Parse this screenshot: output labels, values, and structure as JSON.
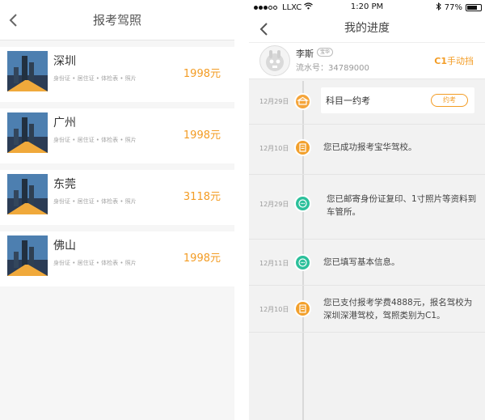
{
  "left_screen": {
    "title": "报考驾照",
    "cities": [
      {
        "name": "深圳",
        "docs": "身份证 • 居住证 • 体检表 • 照片",
        "price": "1998元"
      },
      {
        "name": "广州",
        "docs": "身份证 • 居住证 • 体检表 • 照片",
        "price": "1998元"
      },
      {
        "name": "东莞",
        "docs": "身份证 • 居住证 • 体检表 • 照片",
        "price": "3118元"
      },
      {
        "name": "佛山",
        "docs": "身份证 • 居住证 • 体检表 • 照片",
        "price": "1998元"
      }
    ]
  },
  "right_screen": {
    "status_bar": {
      "carrier": "LLXC",
      "time": "1:20 PM",
      "battery": "77%",
      "battery_level": 0.77
    },
    "title": "我的进度",
    "profile": {
      "name": "李斯",
      "badge": "宝华",
      "serial": "流水号：34789000"
    },
    "manual_label": "手动挡",
    "manual_prefix": "C1",
    "timeline": [
      {
        "date": "12月29日",
        "text": "科目一约考",
        "action": "约考",
        "icon": "exam-icon"
      },
      {
        "date": "12月10日",
        "text": "您已成功报考宝华驾校。",
        "icon": "document-icon"
      },
      {
        "date": "12月29日",
        "text": "您已邮寄身份证复印、1寸照片等资料到车管所。",
        "icon": "chat-icon"
      },
      {
        "date": "12月11日",
        "text": "您已填写基本信息。",
        "icon": "chat-icon"
      },
      {
        "date": "12月10日",
        "text": "您已支付报考学费4888元，报名驾校为深圳深港驾校，驾照类别为C1。",
        "icon": "document-icon"
      }
    ],
    "colors": {
      "accent": "#f39c24",
      "green": "#2cc09b"
    }
  }
}
